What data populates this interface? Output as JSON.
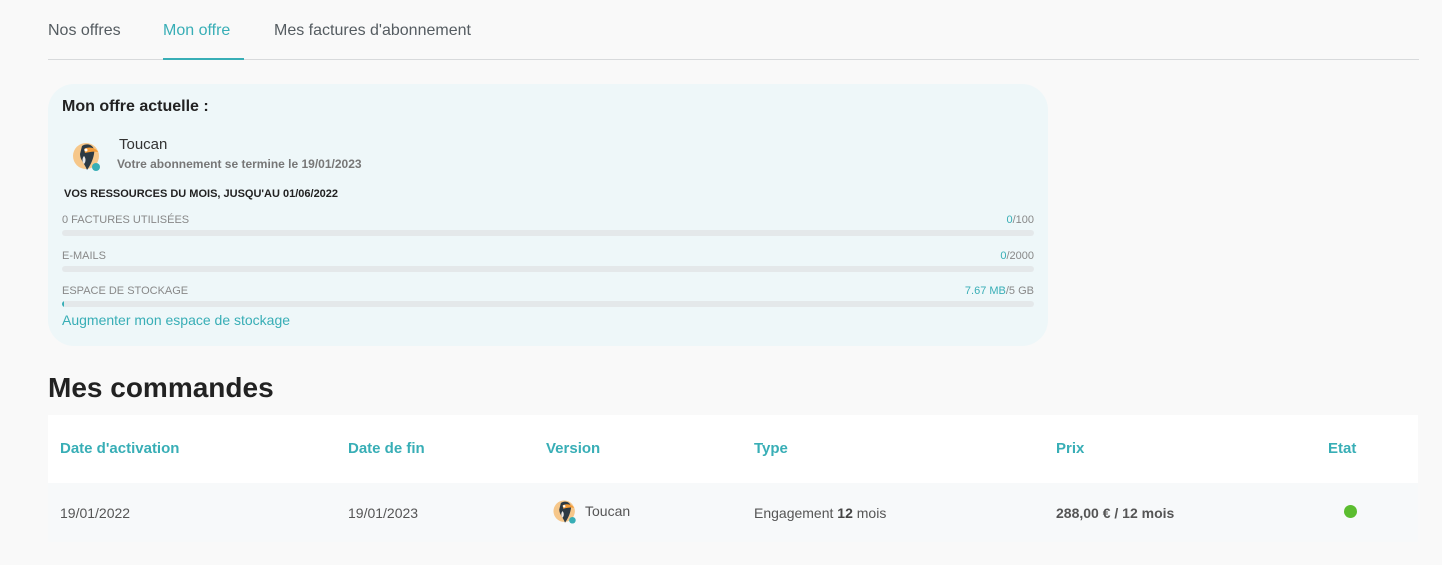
{
  "tabs": [
    {
      "label": "Nos offres",
      "active": false
    },
    {
      "label": "Mon offre",
      "active": true
    },
    {
      "label": "Mes factures d'abonnement",
      "active": false
    }
  ],
  "offer": {
    "title": "Mon offre actuelle :",
    "avatar_icon": "toucan-icon",
    "plan_name": "Toucan",
    "plan_end": "Votre abonnement se termine le 19/01/2023",
    "resources_heading": "VOS RESSOURCES DU MOIS, JUSQU'AU 01/06/2022",
    "resources": [
      {
        "label": "0 FACTURES UTILISÉES",
        "used": "0",
        "total": "/100",
        "fraction": 0
      },
      {
        "label": "E-MAILS",
        "used": "0",
        "total": "/2000",
        "fraction": 0
      },
      {
        "label": "ESPACE DE STOCKAGE",
        "used": "7.67 MB",
        "total": "/5 GB",
        "fraction": 0.0015
      }
    ],
    "storage_link": "Augmenter mon espace de stockage"
  },
  "orders": {
    "title": "Mes commandes",
    "columns": [
      "Date d'activation",
      "Date de fin",
      "Version",
      "Type",
      "Prix",
      "Etat"
    ],
    "rows": [
      {
        "activation": "19/01/2022",
        "end": "19/01/2023",
        "version": "Toucan",
        "type_prefix": "Engagement",
        "type_months": "12",
        "type_suffix": "mois",
        "price": "288,00 € / 12 mois",
        "status": "active",
        "status_color": "#5bbd2f"
      }
    ]
  },
  "colors": {
    "accent": "#38aeb6",
    "success": "#5bbd2f"
  }
}
